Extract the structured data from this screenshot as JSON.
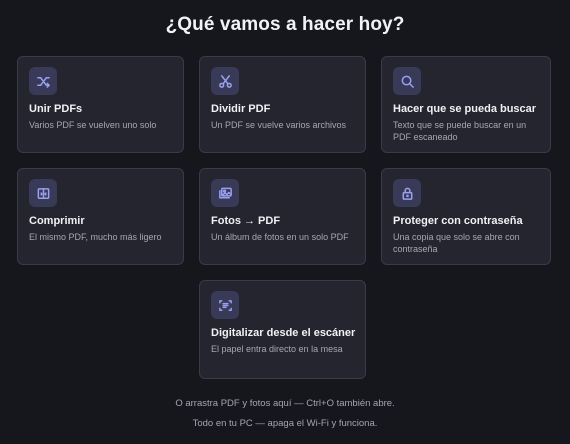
{
  "header": {
    "title": "¿Qué vamos a hacer hoy?"
  },
  "cards": [
    {
      "title": "Unir PDFs",
      "description": "Varios PDF se vuelven uno solo",
      "icon": "merge-icon"
    },
    {
      "title": "Dividir PDF",
      "description": "Un PDF se vuelve varios archivos",
      "icon": "scissors-icon"
    },
    {
      "title": "Hacer que se pueda buscar",
      "description": "Texto que se puede buscar en un PDF escaneado",
      "icon": "search-icon"
    },
    {
      "title": "Comprimir",
      "description": "El mismo PDF, mucho más ligero",
      "icon": "compress-icon"
    },
    {
      "title": "Fotos → PDF",
      "description": "Un álbum de fotos en un solo PDF",
      "icon": "photos-icon"
    },
    {
      "title": "Proteger con contraseña",
      "description": "Una copia que solo se abre con contraseña",
      "icon": "lock-icon"
    },
    {
      "title": "Digitalizar desde el escáner",
      "description": "El papel entra directo en la mesa",
      "icon": "scanner-icon"
    }
  ],
  "footer": {
    "drop_hint": "O arrastra PDF y fotos aquí — Ctrl+O también abre.",
    "offline_note": "Todo en tu PC — apaga el Wi-Fi y funciona."
  },
  "colors": {
    "background": "#16171d",
    "card": "#24252f",
    "card_border": "#3a3b47",
    "icon_bg": "#383a58",
    "accent": "#9aa0ef"
  }
}
